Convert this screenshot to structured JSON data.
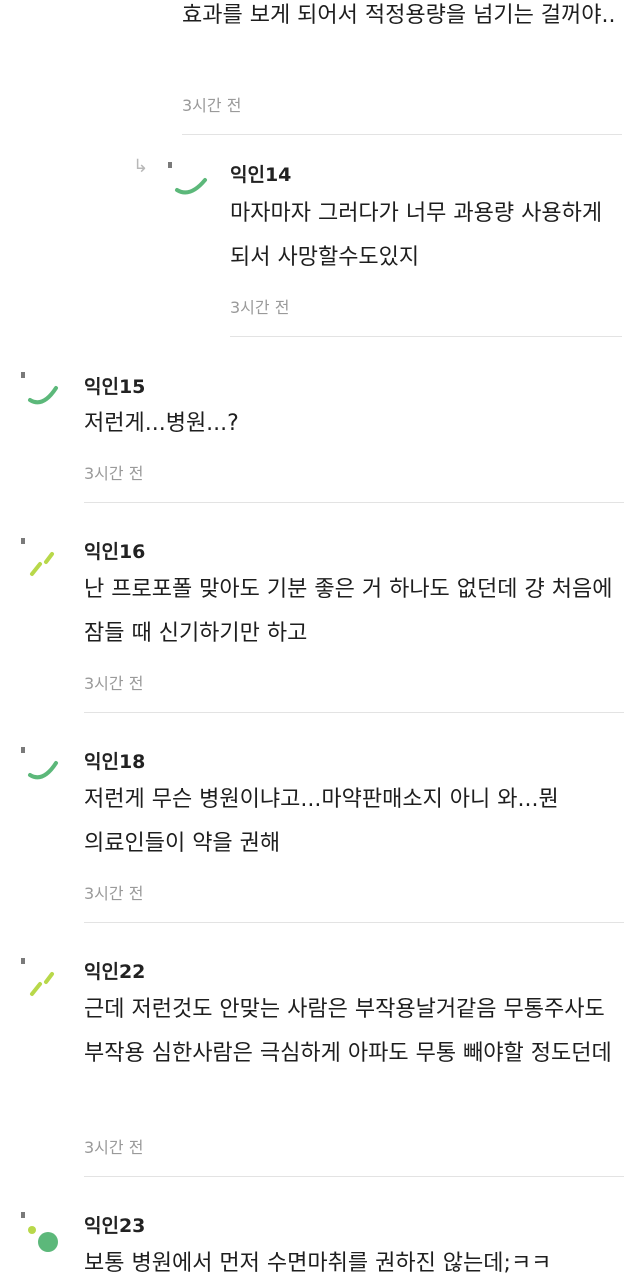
{
  "comments": [
    {
      "author": "",
      "text": "효과를 보게 되어서 적정용량을 넘기는 걸꺼야..",
      "time": "3시간 전"
    },
    {
      "author": "익인14",
      "text": "마자마자 그러다가 너무 과용량 사용하게 되서 사망할수도있지",
      "time": "3시간 전"
    },
    {
      "author": "익인15",
      "text": "저런게...병원...?",
      "time": "3시간 전"
    },
    {
      "author": "익인16",
      "text": "난 프로포폴 맞아도 기분 좋은 거 하나도 없던데 걍 처음에 잠들 때 신기하기만 하고",
      "time": "3시간 전"
    },
    {
      "author": "익인18",
      "text": "저런게 무슨 병원이냐고...마약판매소지 아니 와...뭔 의료인들이 약을 권해",
      "time": "3시간 전"
    },
    {
      "author": "익인22",
      "text": "근데 저런것도 안맞는 사람은 부작용날거같음 무통주사도 부작용 심한사람은 극심하게 아파도 무통 빼야할 정도던데",
      "time": "3시간 전"
    },
    {
      "author": "익인23",
      "text": "보통 병원에서 먼저 수면마취를 권하진 않는데;ㅋㅋ",
      "time": ""
    }
  ],
  "icons": {
    "reply_arrow": "↳",
    "avatar_colors": {
      "green": "#5cb87a",
      "lime": "#b8d84a"
    }
  }
}
